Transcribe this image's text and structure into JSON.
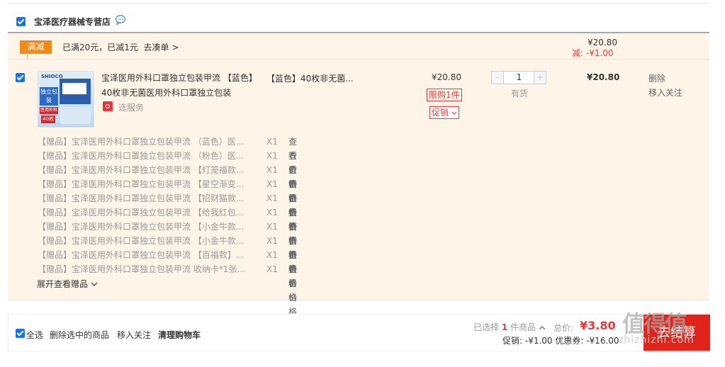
{
  "shop": {
    "name": "宝泽医疗器械专营店"
  },
  "promo": {
    "tag": "满减",
    "text": "已满20元，已减1元",
    "link": "去凑单 >",
    "sum": "¥20.80",
    "minus": "减: -¥1.00"
  },
  "item": {
    "image": {
      "brand": "SHIOCO",
      "badge": "独立包装",
      "stripe": "医用外科",
      "count": "40枚"
    },
    "title": "宝泽医用外科口罩独立包装甲流 【蓝色】40枚非无菌医用外科口罩独立包装",
    "service": "选服务",
    "spec": "【蓝色】40枚非无菌...",
    "unit_price": "¥20.80",
    "limit": "限购1件",
    "promo_button": "促销",
    "qty_minus": "-",
    "qty_value": "1",
    "qty_plus": "+",
    "stock": "有货",
    "subtotal": "¥20.80",
    "delete": "删除",
    "favorite": "移入关注"
  },
  "gifts": [
    {
      "name": "【赠品】宝泽医用外科口罩独立包装甲流 （蓝色）医...",
      "qty": "X1",
      "view": "查看价格"
    },
    {
      "name": "【赠品】宝泽医用外科口罩独立包装甲流 （粉色）医...",
      "qty": "X1",
      "view": "查看价格"
    },
    {
      "name": "【赠品】宝泽医用外科口罩独立包装甲流 【灯笼福款...",
      "qty": "X1",
      "view": "查看价格"
    },
    {
      "name": "【赠品】宝泽医用外科口罩独立包装甲流 【星空渐变...",
      "qty": "X1",
      "view": "查看价格"
    },
    {
      "name": "【赠品】宝泽医用外科口罩独立包装甲流 【招财猫款...",
      "qty": "X1",
      "view": "查看价格"
    },
    {
      "name": "【赠品】宝泽医用外科口罩独立包装甲流 【给我红包...",
      "qty": "X1",
      "view": "查看价格"
    },
    {
      "name": "【赠品】宝泽医用外科口罩独立包装甲流 【小金牛款...",
      "qty": "X1",
      "view": "查看价格"
    },
    {
      "name": "【赠品】宝泽医用外科口罩独立包装甲流 【小金牛款...",
      "qty": "X1",
      "view": "查看价格"
    },
    {
      "name": "【赠品】宝泽医用外科口罩独立包装甲流 【百福款】...",
      "qty": "X1",
      "view": "查看价格"
    },
    {
      "name": "【赠品】宝泽医用外科口罩独立包装甲流 收纳卡*1张...",
      "qty": "X1",
      "view": "查看价格"
    }
  ],
  "expand_gifts": "展开查看赠品",
  "footer": {
    "select_all": "全选",
    "delete_selected": "删除选中的商品",
    "move_to_favorites": "移入关注",
    "clear_cart": "清理购物车",
    "selected_prefix": "已选择",
    "selected_count": "1",
    "selected_suffix": "件商品",
    "total_label": "总价:",
    "total": "¥3.80",
    "promo_line": "促销: -¥1.00 优惠券: -¥16.00",
    "settle": "去结算"
  },
  "watermark": {
    "logo": "值得值",
    "site": "zhizhizhi.com"
  },
  "colors": {
    "accent": "#e4393c",
    "checkbox": "#1a73e8",
    "promo_tag": "#f08a18",
    "band": "#fff4e8",
    "settle": "#e2231a"
  }
}
